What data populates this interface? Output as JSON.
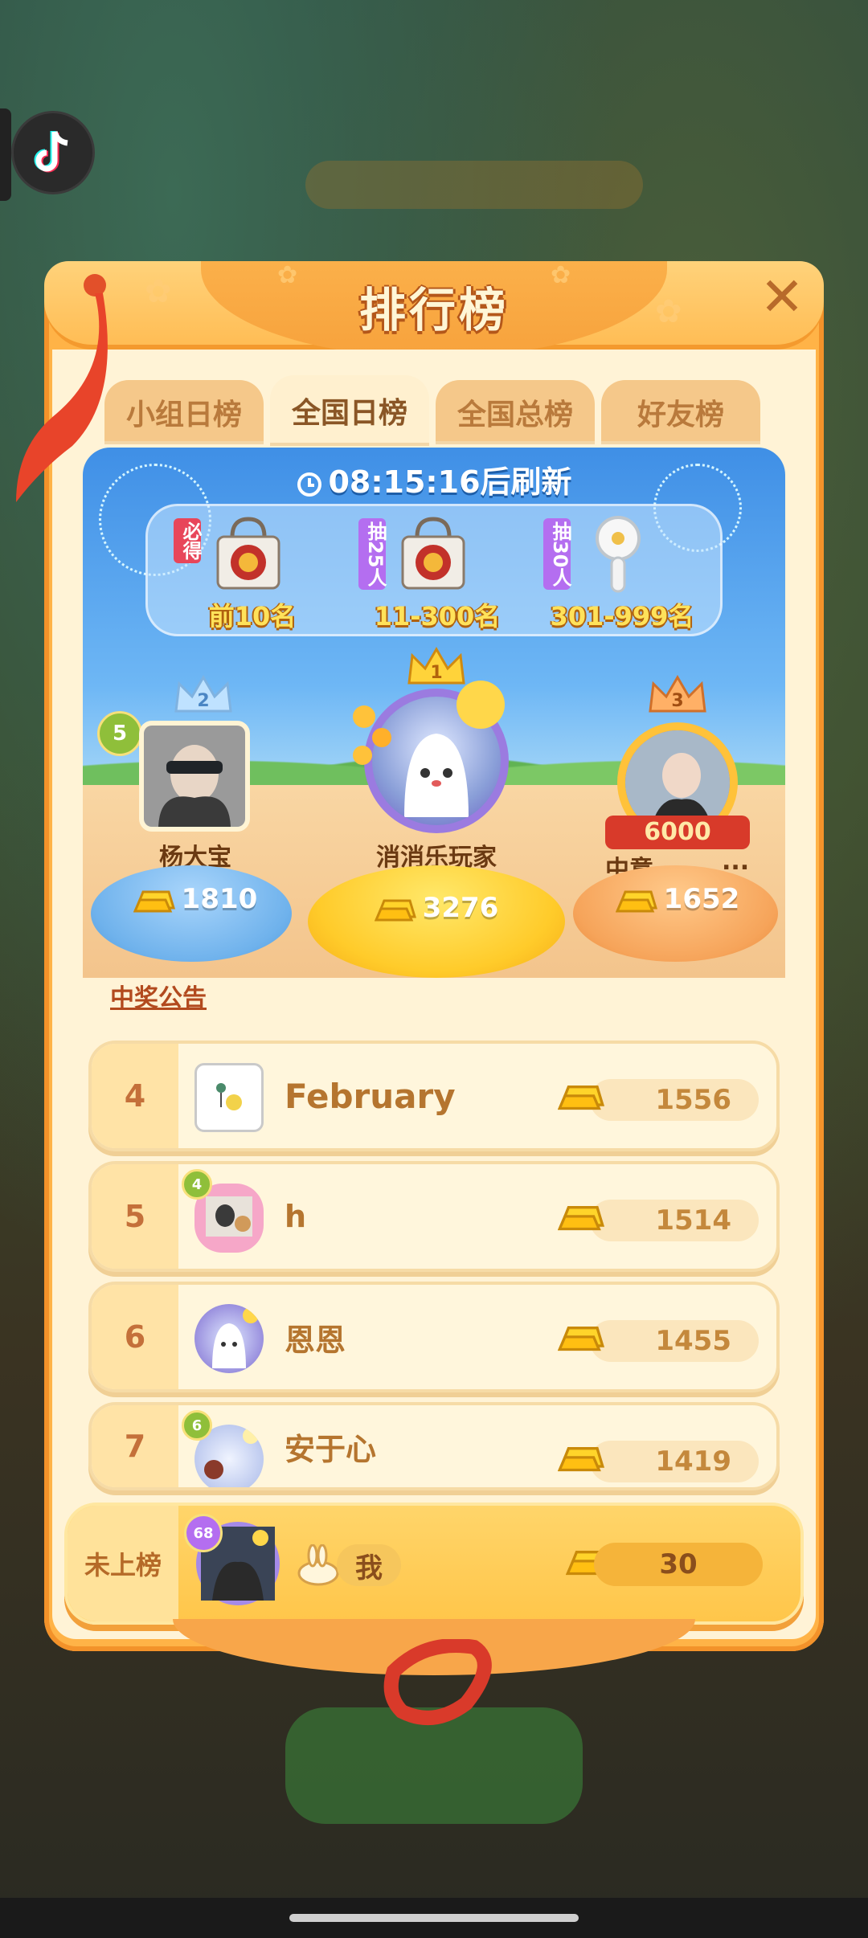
{
  "header": {
    "title": "排行榜"
  },
  "tabs": [
    {
      "label": "小组日榜",
      "active": false
    },
    {
      "label": "全国日榜",
      "active": true
    },
    {
      "label": "全国总榜",
      "active": false
    },
    {
      "label": "好友榜",
      "active": false
    }
  ],
  "stage": {
    "timer": "08:15:16后刷新",
    "prizes": [
      {
        "tag": "必得",
        "tag_color": "#e8465a",
        "range": "前10名",
        "icon": "tote-bag-icon"
      },
      {
        "tag": "抽25人",
        "tag_color": "#b46ef0",
        "range": "11-300名",
        "icon": "tote-bag-icon"
      },
      {
        "tag": "抽30人",
        "tag_color": "#b46ef0",
        "range": "301-999名",
        "icon": "handheld-fan-icon"
      }
    ]
  },
  "podium": {
    "first": {
      "rank": "1",
      "name": "消消乐玩家",
      "score": "3276"
    },
    "second": {
      "rank": "2",
      "name": "杨大宝",
      "score": "1810",
      "level": "5"
    },
    "third": {
      "rank": "3",
      "name": "中意",
      "score": "1652",
      "more": "...",
      "frame_text": "6000"
    }
  },
  "notice": {
    "label": "中奖公告"
  },
  "rows": [
    {
      "rank": "4",
      "name": "February",
      "score": "1556"
    },
    {
      "rank": "5",
      "name": "h",
      "score": "1514",
      "level": "4"
    },
    {
      "rank": "6",
      "name": "恩恩",
      "score": "1455"
    },
    {
      "rank": "7",
      "name": "安于心",
      "score": "1419",
      "level": "6"
    }
  ],
  "me": {
    "label": "未上榜",
    "name": "我",
    "score": "30",
    "level": "68"
  },
  "colors": {
    "panel": "#ffb347",
    "accent_gold": "#ffe25a",
    "stage_blue": "#3f8fe6"
  }
}
